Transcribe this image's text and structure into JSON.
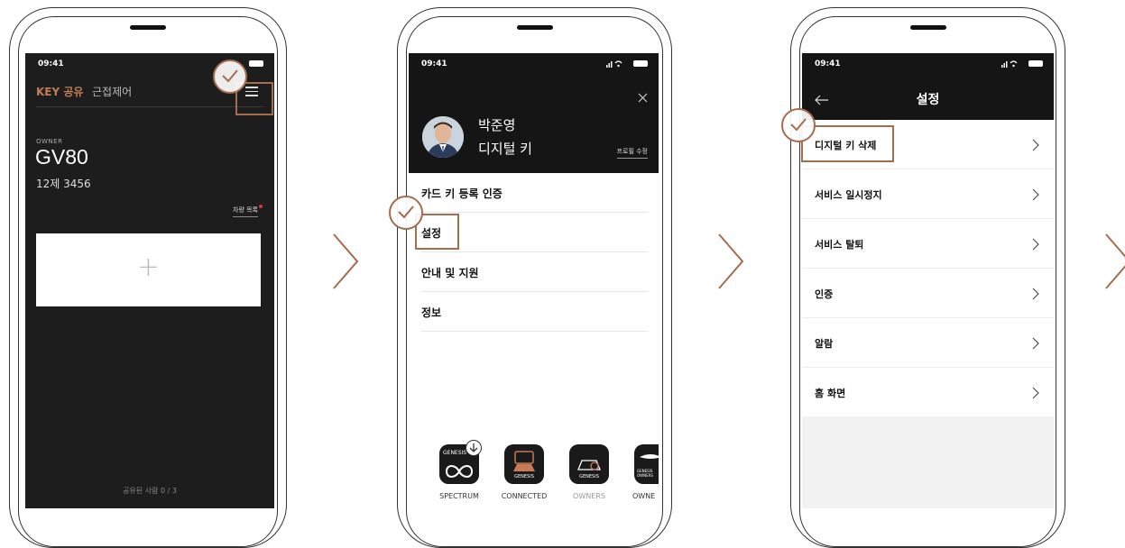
{
  "screen1": {
    "time": "09:41",
    "tabs": [
      {
        "label": "KEY 공유",
        "active": true
      },
      {
        "label": "근접제어",
        "active": false
      }
    ],
    "owner_label": "OWNER",
    "model": "GV80",
    "plate": "12제 3456",
    "vehicle_list_link": "차량 목록",
    "add_symbol": "+",
    "shared_count": "공유된 사람 0 / 3"
  },
  "screen2": {
    "time": "09:41",
    "user_name": "박준영",
    "subtitle": "디지털 키",
    "profile_edit": "프로필 수정",
    "menu": [
      {
        "label": "카드 키 등록 인증"
      },
      {
        "label": "설정"
      },
      {
        "label": "안내 및 지원"
      },
      {
        "label": "정보"
      }
    ],
    "apps": [
      {
        "name": "SPECTRUM",
        "icon_text": "GENESIS"
      },
      {
        "name": "CONNECTED",
        "icon_text": "GENESIS"
      },
      {
        "name": "OWNERS",
        "icon_text": "GENESIS"
      },
      {
        "name": "OWNE",
        "icon_text": "GENESIS OWNERS"
      }
    ]
  },
  "screen3": {
    "time": "09:41",
    "title": "설정",
    "items": [
      {
        "label": "디지털 키 삭제"
      },
      {
        "label": "서비스 일시정지"
      },
      {
        "label": "서비스 탈퇴"
      },
      {
        "label": "인증"
      },
      {
        "label": "알람"
      },
      {
        "label": "홈 화면"
      }
    ]
  },
  "colors": {
    "accent": "#a36d4e",
    "active_tab": "#c47a55",
    "dark_bg": "#1d1d1d",
    "header_bg": "#151515",
    "badge_red": "#e0323c"
  }
}
